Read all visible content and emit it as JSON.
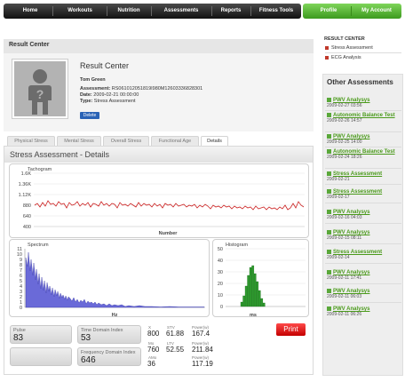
{
  "nav": {
    "items": [
      "Home",
      "Workouts",
      "Nutrition",
      "Assessments",
      "Reports",
      "Fitness Tools"
    ],
    "right_items": [
      "Profile",
      "My Account"
    ]
  },
  "result_center": {
    "header": "Result Center",
    "title": "Result Center",
    "name": "Tom Green",
    "assessment_label": "Assessment:",
    "assessment_value": "RS061012051819I980M12603336828301",
    "date_label": "Date:",
    "date_value": "2009-02-21 00:00:00",
    "type_label": "Type:",
    "type_value": "Stress Assessment",
    "delete_label": "Delete"
  },
  "tabs": [
    "Physical Stress",
    "Mental Stress",
    "Overall Stress",
    "Functional Age",
    "Details"
  ],
  "active_tab": "Details",
  "details": {
    "title": "Stress Assessment - Details",
    "tachogram": {
      "title": "Tachogram",
      "xlabel": "Number",
      "yticks": [
        "1.6K",
        "1.36K",
        "1.12K",
        "880",
        "640",
        "400"
      ]
    },
    "spectrum": {
      "title": "Spectrum",
      "xlabel": "Hz",
      "yticks": [
        "11",
        "10",
        "9",
        "8",
        "7",
        "6",
        "5",
        "4",
        "3",
        "2",
        "1",
        "0"
      ]
    },
    "histogram": {
      "title": "Histogram",
      "xlabel": "ms",
      "yticks": [
        "50",
        "40",
        "30",
        "20",
        "10",
        "0"
      ]
    }
  },
  "metrics": {
    "pulse_label": "Pulse",
    "pulse_value": "83",
    "time_domain_label": "Time Domain Index",
    "time_domain_value": "53",
    "freq_domain_label": "Frequency Domain Index",
    "freq_domain_value": "646",
    "stats": {
      "x_label": "X",
      "x_value": "800",
      "stv_label": "STV",
      "stv_value": "61.88",
      "power_label": "Power(w)",
      "power1_value": "167.4",
      "mo_label": "Mo",
      "mo_value": "760",
      "ltv_label": "LTV",
      "ltv_value": "52.55",
      "power2_value": "211.84",
      "amo_label": "AMo",
      "amo_value": "36",
      "power3_value": "117.19"
    },
    "print_label": "Print"
  },
  "sidebar": {
    "title": "RESULT CENTER",
    "links": [
      "Stress Assessment",
      "ECG Analysis"
    ],
    "other_title": "Other Assessments",
    "other": [
      {
        "name": "PWV Analysys",
        "date": "2009-02-27 03:56"
      },
      {
        "name": "Autonomic Balance Test",
        "date": "2009-02-26 14:57"
      },
      {
        "name": "PWV Analysys",
        "date": "2009-02-25 14:00"
      },
      {
        "name": "Autonomic Balance Test",
        "date": "2009-02-24 18:26"
      },
      {
        "name": "Stress Assessment",
        "date": "2009-02-21"
      },
      {
        "name": "Stress Assessment",
        "date": "2009-02-17"
      },
      {
        "name": "PWV Analysys",
        "date": "2009-02-16 04:03"
      },
      {
        "name": "PWV Analysys",
        "date": "2009-02-15 08:11"
      },
      {
        "name": "Stress Assessment",
        "date": "2009-02-14"
      },
      {
        "name": "PWV Analysys",
        "date": "2009-02-11 17:41"
      },
      {
        "name": "PWV Analysys",
        "date": "2009-02-11 06:03"
      },
      {
        "name": "PWV Analysys",
        "date": "2009-02-11 06:26"
      }
    ]
  },
  "colors": {
    "nav_dark": "#222222",
    "nav_green": "#5cb83a",
    "accent_green": "#4a9a1a",
    "tachogram_line": "#cc2222",
    "spectrum_fill": "#6a6ad8",
    "histogram_bar": "#2e9a2e",
    "print_button": "#e00000"
  }
}
